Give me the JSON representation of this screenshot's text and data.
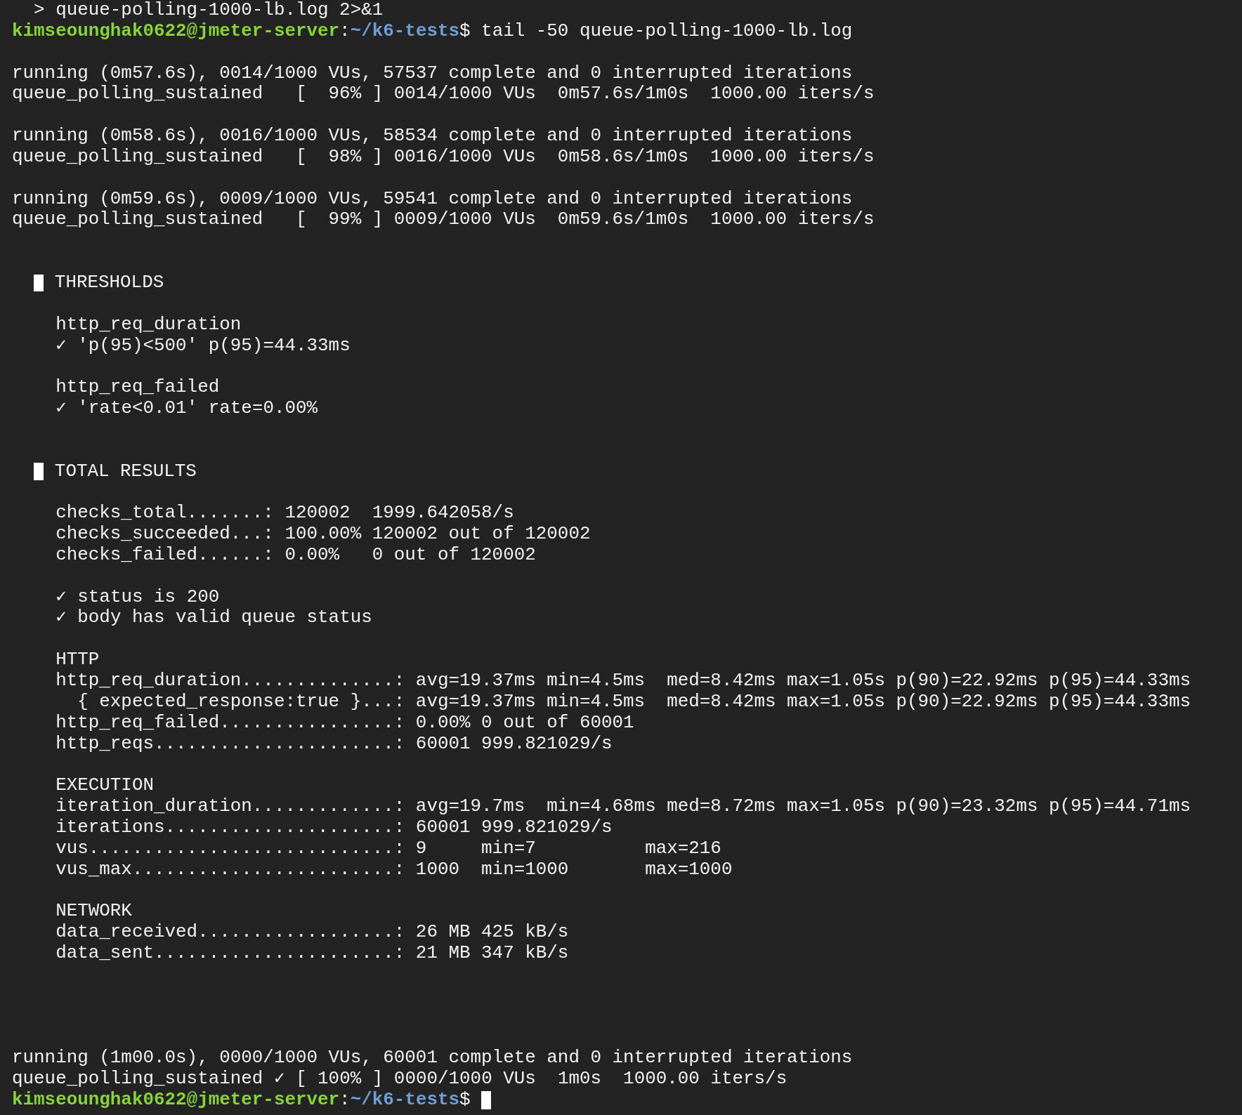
{
  "terminal": {
    "lines": [
      {
        "kind": "text",
        "text": "  > queue-polling-1000-lb.log 2>&1"
      },
      {
        "kind": "prompt",
        "user": "kimseounghak0622@jmeter-server",
        "separator": ":",
        "path": "~/k6-tests",
        "symbol": "$",
        "command": "tail -50 queue-polling-1000-lb.log",
        "cursor": false
      },
      {
        "kind": "blank"
      },
      {
        "kind": "text",
        "text": "running (0m57.6s), 0014/1000 VUs, 57537 complete and 0 interrupted iterations"
      },
      {
        "kind": "text",
        "text": "queue_polling_sustained   [  96% ] 0014/1000 VUs  0m57.6s/1m0s  1000.00 iters/s"
      },
      {
        "kind": "blank"
      },
      {
        "kind": "text",
        "text": "running (0m58.6s), 0016/1000 VUs, 58534 complete and 0 interrupted iterations"
      },
      {
        "kind": "text",
        "text": "queue_polling_sustained   [  98% ] 0016/1000 VUs  0m58.6s/1m0s  1000.00 iters/s"
      },
      {
        "kind": "blank"
      },
      {
        "kind": "text",
        "text": "running (0m59.6s), 0009/1000 VUs, 59541 complete and 0 interrupted iterations"
      },
      {
        "kind": "text",
        "text": "queue_polling_sustained   [  99% ] 0009/1000 VUs  0m59.6s/1m0s  1000.00 iters/s"
      },
      {
        "kind": "blank"
      },
      {
        "kind": "blank"
      },
      {
        "kind": "heading",
        "text": "THRESHOLDS"
      },
      {
        "kind": "blank"
      },
      {
        "kind": "text",
        "text": "    http_req_duration"
      },
      {
        "kind": "text",
        "text": "    ✓ 'p(95)<500' p(95)=44.33ms"
      },
      {
        "kind": "blank"
      },
      {
        "kind": "text",
        "text": "    http_req_failed"
      },
      {
        "kind": "text",
        "text": "    ✓ 'rate<0.01' rate=0.00%"
      },
      {
        "kind": "blank"
      },
      {
        "kind": "blank"
      },
      {
        "kind": "heading",
        "text": "TOTAL RESULTS"
      },
      {
        "kind": "blank"
      },
      {
        "kind": "text",
        "text": "    checks_total.......: 120002  1999.642058/s"
      },
      {
        "kind": "text",
        "text": "    checks_succeeded...: 100.00% 120002 out of 120002"
      },
      {
        "kind": "text",
        "text": "    checks_failed......: 0.00%   0 out of 120002"
      },
      {
        "kind": "blank"
      },
      {
        "kind": "text",
        "text": "    ✓ status is 200"
      },
      {
        "kind": "text",
        "text": "    ✓ body has valid queue status"
      },
      {
        "kind": "blank"
      },
      {
        "kind": "text",
        "text": "    HTTP"
      },
      {
        "kind": "text",
        "text": "    http_req_duration..............: avg=19.37ms min=4.5ms  med=8.42ms max=1.05s p(90)=22.92ms p(95)=44.33ms"
      },
      {
        "kind": "text",
        "text": "      { expected_response:true }...: avg=19.37ms min=4.5ms  med=8.42ms max=1.05s p(90)=22.92ms p(95)=44.33ms"
      },
      {
        "kind": "text",
        "text": "    http_req_failed................: 0.00% 0 out of 60001"
      },
      {
        "kind": "text",
        "text": "    http_reqs......................: 60001 999.821029/s"
      },
      {
        "kind": "blank"
      },
      {
        "kind": "text",
        "text": "    EXECUTION"
      },
      {
        "kind": "text",
        "text": "    iteration_duration.............: avg=19.7ms  min=4.68ms med=8.72ms max=1.05s p(90)=23.32ms p(95)=44.71ms"
      },
      {
        "kind": "text",
        "text": "    iterations.....................: 60001 999.821029/s"
      },
      {
        "kind": "text",
        "text": "    vus............................: 9     min=7          max=216"
      },
      {
        "kind": "text",
        "text": "    vus_max........................: 1000  min=1000       max=1000"
      },
      {
        "kind": "blank"
      },
      {
        "kind": "text",
        "text": "    NETWORK"
      },
      {
        "kind": "text",
        "text": "    data_received..................: 26 MB 425 kB/s"
      },
      {
        "kind": "text",
        "text": "    data_sent......................: 21 MB 347 kB/s"
      },
      {
        "kind": "blank"
      },
      {
        "kind": "blank"
      },
      {
        "kind": "blank"
      },
      {
        "kind": "blank"
      },
      {
        "kind": "text",
        "text": "running (1m00.0s), 0000/1000 VUs, 60001 complete and 0 interrupted iterations"
      },
      {
        "kind": "text",
        "text": "queue_polling_sustained ✓ [ 100% ] 0000/1000 VUs  1m0s  1000.00 iters/s"
      },
      {
        "kind": "prompt",
        "user": "kimseounghak0622@jmeter-server",
        "separator": ":",
        "path": "~/k6-tests",
        "symbol": "$",
        "cursor": true
      }
    ]
  }
}
